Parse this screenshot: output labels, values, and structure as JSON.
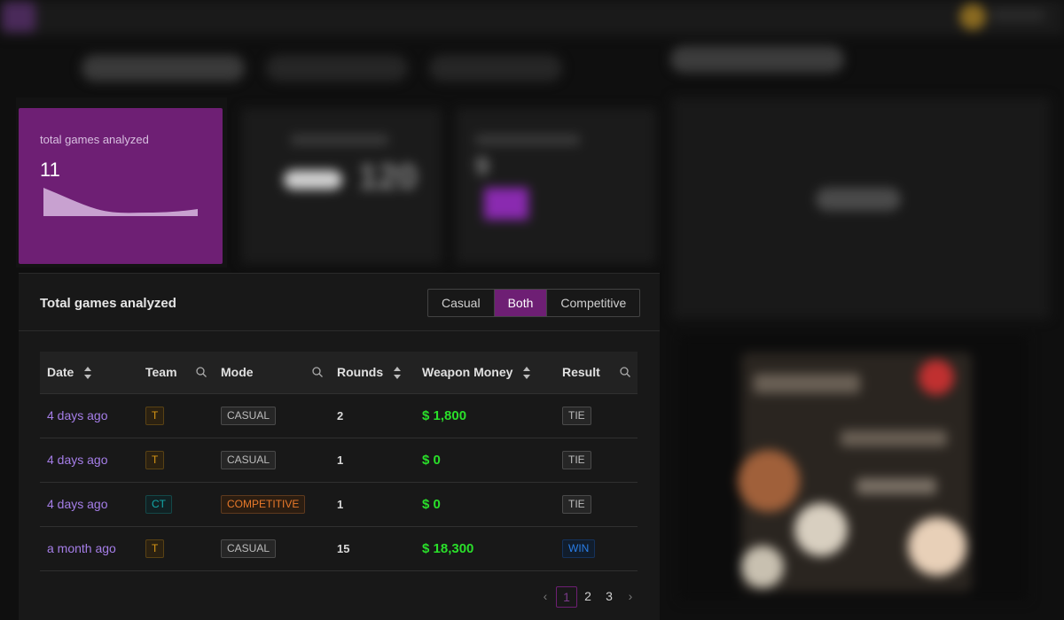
{
  "stat_card": {
    "label": "total games analyzed",
    "value": "11"
  },
  "panel": {
    "title": "Total games analyzed",
    "segments": [
      "Casual",
      "Both",
      "Competitive"
    ],
    "active_segment": "Both"
  },
  "table": {
    "headers": {
      "date": "Date",
      "team": "Team",
      "mode": "Mode",
      "rounds": "Rounds",
      "weapon_money": "Weapon Money",
      "result": "Result"
    },
    "rows": [
      {
        "date": "4 days ago",
        "team": "T",
        "mode": "CASUAL",
        "rounds": "2",
        "money": "$ 1,800",
        "result": "TIE"
      },
      {
        "date": "4 days ago",
        "team": "T",
        "mode": "CASUAL",
        "rounds": "1",
        "money": "$ 0",
        "result": "TIE"
      },
      {
        "date": "4 days ago",
        "team": "CT",
        "mode": "COMPETITIVE",
        "rounds": "1",
        "money": "$ 0",
        "result": "TIE"
      },
      {
        "date": "a month ago",
        "team": "T",
        "mode": "CASUAL",
        "rounds": "15",
        "money": "$ 18,300",
        "result": "WIN"
      }
    ]
  },
  "pagination": {
    "pages": [
      "1",
      "2",
      "3"
    ],
    "current": "1"
  },
  "colors": {
    "accent": "#6e1f74",
    "money": "#2adf2a",
    "link": "#a57ee8"
  }
}
